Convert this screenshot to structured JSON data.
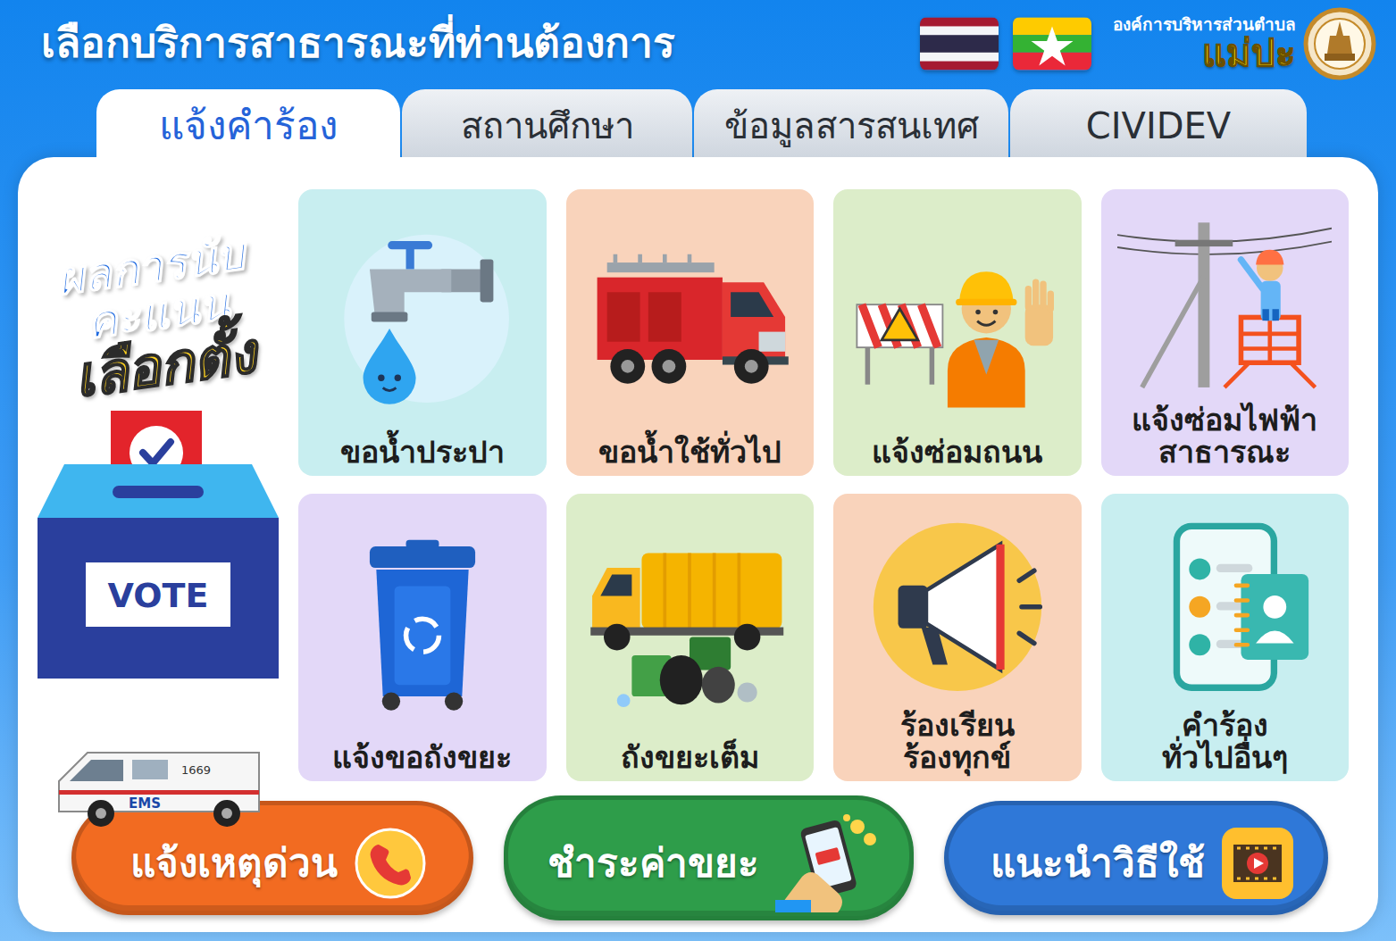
{
  "header": {
    "title": "เลือกบริการสาธารณะที่ท่านต้องการ"
  },
  "org": {
    "line1": "องค์การบริหารส่วนตำบล",
    "name": "แม่ปะ"
  },
  "tabs": [
    {
      "label": "แจ้งคำร้อง",
      "selected": true
    },
    {
      "label": "สถานศึกษา",
      "selected": false
    },
    {
      "label": "ข้อมูลสารสนเทศ",
      "selected": false
    },
    {
      "label": "CIVIDEV",
      "selected": false
    }
  ],
  "election": {
    "lines": [
      "ผลการนับ",
      "คะแนน",
      "เลือกตั้ง"
    ],
    "box_label": "VOTE"
  },
  "services": [
    {
      "lines": [
        "ขอน้ำประปา"
      ],
      "color": "#c8eef0"
    },
    {
      "lines": [
        "ขอน้ำใช้ทั่วไป"
      ],
      "color": "#f9d3bb"
    },
    {
      "lines": [
        "แจ้งซ่อมถนน"
      ],
      "color": "#dcedc9"
    },
    {
      "lines": [
        "แจ้งซ่อมไฟฟ้า",
        "สาธารณะ"
      ],
      "color": "#e3d8f8"
    },
    {
      "lines": [
        "แจ้งขอถังขยะ"
      ],
      "color": "#e3d8f8"
    },
    {
      "lines": [
        "ถังขยะเต็ม"
      ],
      "color": "#dcedc9"
    },
    {
      "lines": [
        "ร้องเรียน",
        "ร้องทุกข์"
      ],
      "color": "#f9d3bb"
    },
    {
      "lines": [
        "คำร้อง",
        "ทั่วไปอื่นๆ"
      ],
      "color": "#c8eef0"
    }
  ],
  "ambulance": {
    "number": "1669",
    "label": "EMS"
  },
  "actions": [
    {
      "label": "แจ้งเหตุด่วน",
      "color": "#f26b21"
    },
    {
      "label": "ชำระค่าขยะ",
      "color": "#2e9d4a"
    },
    {
      "label": "แนะนำวิธีใช้",
      "color": "#2f78d8"
    }
  ]
}
